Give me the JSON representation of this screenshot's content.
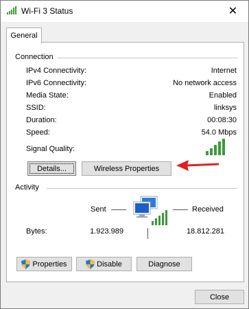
{
  "window": {
    "title": "Wi-Fi 3 Status",
    "icon": "wifi-signal-icon",
    "close_glyph": "✕"
  },
  "tabs": [
    {
      "label": "General"
    }
  ],
  "connection": {
    "title": "Connection",
    "rows": [
      {
        "label": "IPv4 Connectivity:",
        "value": "Internet"
      },
      {
        "label": "IPv6 Connectivity:",
        "value": "No network access"
      },
      {
        "label": "Media State:",
        "value": "Enabled"
      },
      {
        "label": "SSID:",
        "value": "linksys"
      },
      {
        "label": "Duration:",
        "value": "00:08:30"
      },
      {
        "label": "Speed:",
        "value": "54.0 Mbps"
      }
    ],
    "signal_label": "Signal Quality:",
    "signal_bars": 5,
    "buttons": {
      "details": "Details...",
      "wireless_properties": "Wireless Properties"
    }
  },
  "activity": {
    "title": "Activity",
    "sent_label": "Sent",
    "received_label": "Received",
    "bytes_label": "Bytes:",
    "bytes_sent": "1.923.989",
    "bytes_received": "18.812.281",
    "icon": "network-computer-icon"
  },
  "actions": {
    "properties": "Properties",
    "disable": "Disable",
    "diagnose": "Diagnose"
  },
  "footer": {
    "close": "Close"
  },
  "colors": {
    "signal_green": "#3a9a3a",
    "arrow_red": "#e02020",
    "button_face": "#e1e1e1"
  }
}
